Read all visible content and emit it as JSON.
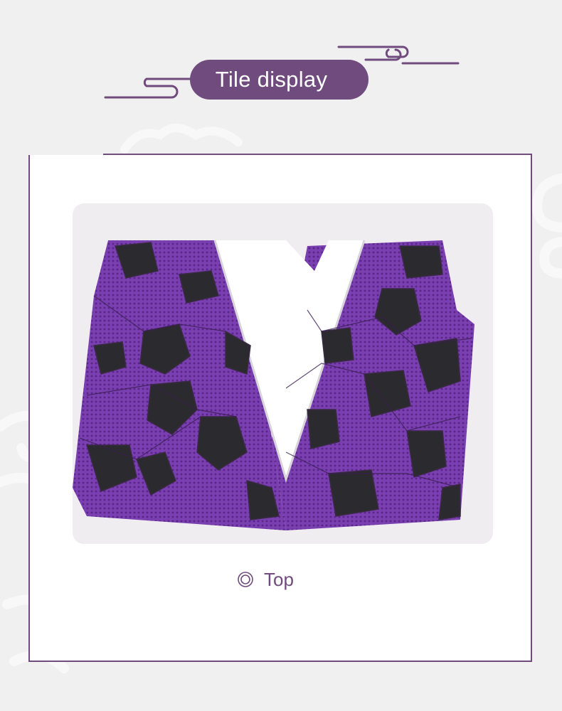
{
  "header": {
    "title": "Tile display"
  },
  "photo": {
    "subject": "purple-black-tile-pattern-haori-folded",
    "accent": "#7a3fb0"
  },
  "caption": {
    "icon": "double-ring-icon",
    "label": "Top"
  },
  "colors": {
    "accent": "#6f4b7e",
    "background": "#f1f0f1",
    "panel": "#ffffff"
  }
}
